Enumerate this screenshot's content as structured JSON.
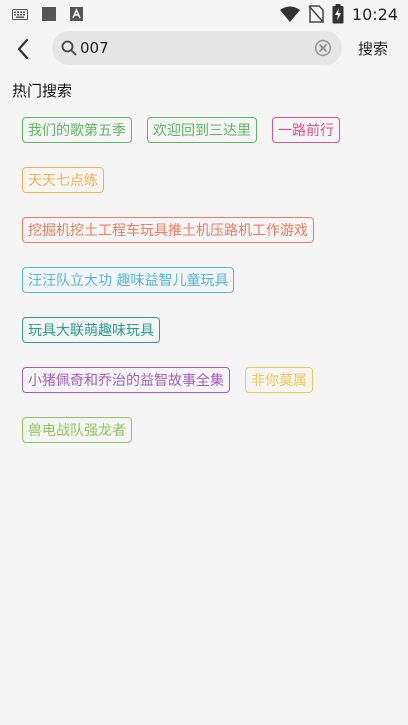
{
  "status_bar": {
    "time": "10:24",
    "left_icons": [
      "keyboard-icon",
      "square-icon",
      "font-icon"
    ],
    "right_icons": [
      "wifi-icon",
      "no-sim-icon",
      "battery-charging-icon"
    ]
  },
  "search": {
    "value": "007",
    "submit_label": "搜索"
  },
  "hot_search": {
    "title": "热门搜索",
    "tags": [
      {
        "label": "我们的歌第五季",
        "color": "#5cb85c"
      },
      {
        "label": "欢迎回到三达里",
        "color": "#5cb85c"
      },
      {
        "label": "一路前行",
        "color": "#e0508a"
      },
      {
        "label": "天天七点练",
        "color": "#f2b24a"
      },
      {
        "label": "挖掘机挖土工程车玩具推土机压路机工作游戏",
        "color": "#f07a5a"
      },
      {
        "label": "汪汪队立大功 趣味益智儿童玩具",
        "color": "#4cb8e0"
      },
      {
        "label": "玩具大联萌趣味玩具",
        "color": "#2a9d8f"
      },
      {
        "label": "小猪佩奇和乔治的益智故事全集",
        "color": "#a55cc0"
      },
      {
        "label": "非你莫属",
        "color": "#f2c94c"
      },
      {
        "label": "兽电战队强龙者",
        "color": "#8cc65a"
      }
    ]
  }
}
